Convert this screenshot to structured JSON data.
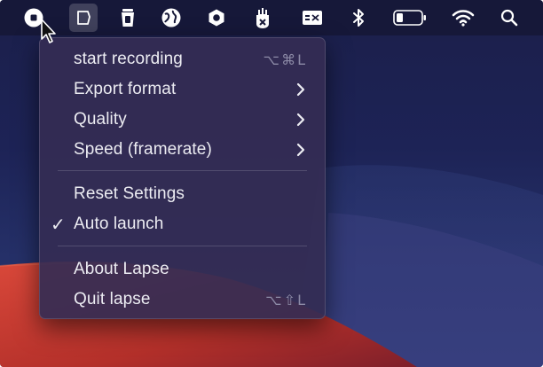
{
  "menubar": {
    "icons": [
      "lapse-record-icon",
      "crop-screen-icon",
      "trash-can-icon",
      "globe-icon",
      "hexagon-logo-icon",
      "sparkle-hand-icon",
      "caption-card-icon",
      "bluetooth-icon",
      "battery-icon",
      "wifi-icon",
      "search-icon"
    ]
  },
  "menu": {
    "items": [
      {
        "label": "start recording",
        "shortcut": "⌥⌘L"
      },
      {
        "label": "Export format",
        "submenu": true
      },
      {
        "label": "Quality",
        "submenu": true
      },
      {
        "label": "Speed (framerate)",
        "submenu": true
      },
      {
        "label": "Reset Settings"
      },
      {
        "label": "Auto launch",
        "checked": true,
        "check": "✓"
      },
      {
        "label": "About Lapse"
      },
      {
        "label": "Quit lapse",
        "shortcut": "⌥⇧L"
      }
    ]
  },
  "colors": {
    "menu_bg": "#342c54",
    "menubar_bg": "#161838",
    "text": "#ececf2",
    "shortcut": "#8c8aa6",
    "wallpaper_red": "#c23a2f"
  }
}
